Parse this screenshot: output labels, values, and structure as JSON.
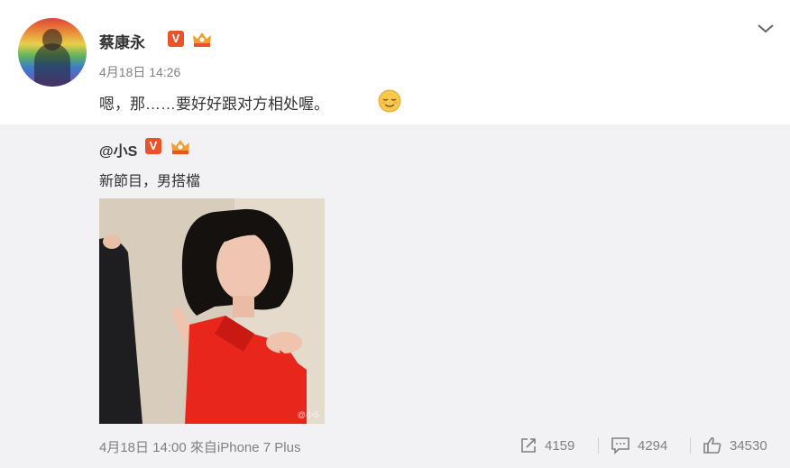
{
  "post": {
    "author": "蔡康永",
    "verified_badge": "V",
    "time": "4月18日 14:26",
    "text": "嗯，那……要好好跟对方相处喔。",
    "emoji": "relieved-face-emoji"
  },
  "repost": {
    "author": "@小S",
    "verified_badge": "V",
    "text": "新節目，男搭檔",
    "image_watermark": "@小S",
    "meta": "4月18日 14:00 來自iPhone 7 Plus",
    "shares": "4159",
    "comments": "4294",
    "likes": "34530"
  },
  "colors": {
    "badge": "#e8532a",
    "muted": "#808080",
    "repost_bg": "#f2f2f5"
  }
}
